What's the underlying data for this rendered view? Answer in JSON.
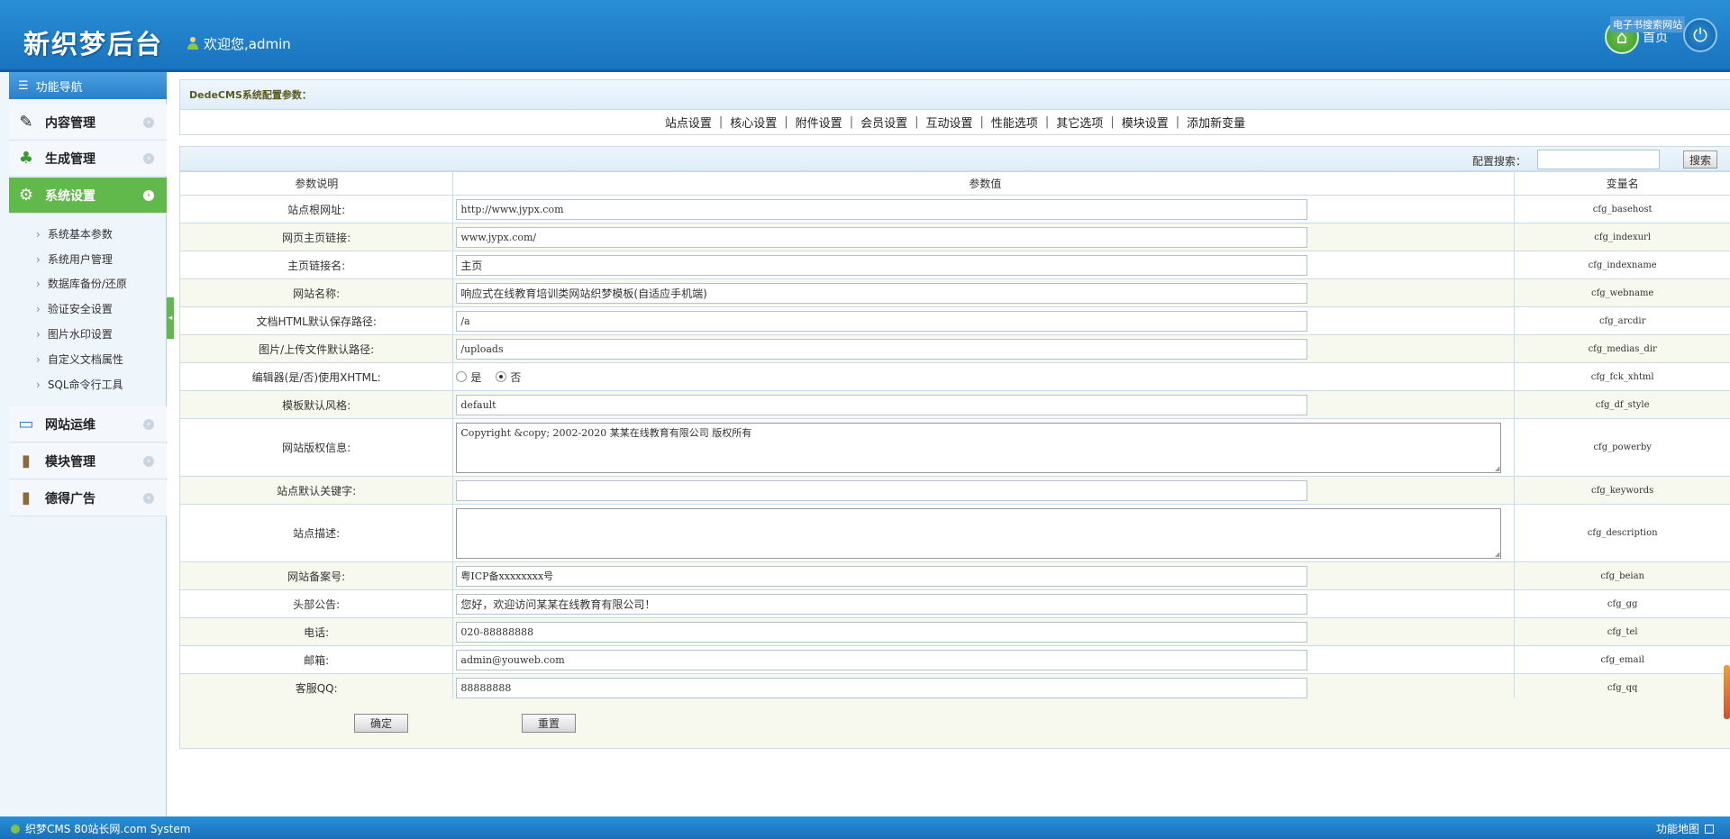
{
  "header": {
    "logo": "新织梦后台",
    "welcome": "欢迎您,admin",
    "home_label": "首页",
    "home_tag": "电子书搜索网站"
  },
  "sidebar": {
    "title": "功能导航",
    "sections": [
      {
        "label": "内容管理",
        "icon": "pencil-icon"
      },
      {
        "label": "生成管理",
        "icon": "tree-icon"
      },
      {
        "label": "系统设置",
        "icon": "gears-icon"
      },
      {
        "label": "网站运维",
        "icon": "monitor-icon"
      },
      {
        "label": "模块管理",
        "icon": "book-icon"
      },
      {
        "label": "德得广告",
        "icon": "book-icon"
      }
    ],
    "sub_items": [
      "系统基本参数",
      "系统用户管理",
      "数据库备份/还原",
      "验证安全设置",
      "图片水印设置",
      "自定义文档属性",
      "SQL命令行工具"
    ]
  },
  "main": {
    "title": "DedeCMS系统配置参数：",
    "tabs": [
      "站点设置",
      "核心设置",
      "附件设置",
      "会员设置",
      "互动设置",
      "性能选项",
      "其它选项",
      "模块设置",
      "添加新变量"
    ],
    "search_label": "配置搜索：",
    "search_button": "搜索",
    "columns": [
      "参数说明",
      "参数值",
      "变量名"
    ],
    "rows": [
      {
        "label": "站点根网址:",
        "value": "http://www.jypx.com",
        "var": "cfg_basehost",
        "type": "input"
      },
      {
        "label": "网页主页链接:",
        "value": "www.jypx.com/",
        "var": "cfg_indexurl",
        "type": "input"
      },
      {
        "label": "主页链接名:",
        "value": "主页",
        "var": "cfg_indexname",
        "type": "input"
      },
      {
        "label": "网站名称:",
        "value": "响应式在线教育培训类网站织梦模板(自适应手机端)",
        "var": "cfg_webname",
        "type": "input"
      },
      {
        "label": "文档HTML默认保存路径:",
        "value": "/a",
        "var": "cfg_arcdir",
        "type": "input"
      },
      {
        "label": "图片/上传文件默认路径:",
        "value": "/uploads",
        "var": "cfg_medias_dir",
        "type": "input"
      },
      {
        "label": "编辑器(是/否)使用XHTML:",
        "value": "",
        "var": "cfg_fck_xhtml",
        "type": "radio",
        "options": [
          "是",
          "否"
        ],
        "selected": "否"
      },
      {
        "label": "模板默认风格:",
        "value": "default",
        "var": "cfg_df_style",
        "type": "input"
      },
      {
        "label": "网站版权信息:",
        "value": "Copyright &copy; 2002-2020 某某在线教育有限公司 版权所有",
        "var": "cfg_powerby",
        "type": "textarea"
      },
      {
        "label": "站点默认关键字:",
        "value": "",
        "var": "cfg_keywords",
        "type": "input"
      },
      {
        "label": "站点描述:",
        "value": "",
        "var": "cfg_description",
        "type": "textarea"
      },
      {
        "label": "网站备案号:",
        "value": "粤ICP备xxxxxxxx号",
        "var": "cfg_beian",
        "type": "input"
      },
      {
        "label": "头部公告:",
        "value": "您好，欢迎访问某某在线教育有限公司！",
        "var": "cfg_gg",
        "type": "input"
      },
      {
        "label": "电话:",
        "value": "020-88888888",
        "var": "cfg_tel",
        "type": "input"
      },
      {
        "label": "邮箱:",
        "value": "admin@youweb.com",
        "var": "cfg_email",
        "type": "input"
      },
      {
        "label": "客服QQ:",
        "value": "88888888",
        "var": "cfg_qq",
        "type": "input"
      }
    ],
    "confirm_button": "确定",
    "reset_button": "重置"
  },
  "footer": {
    "left": "织梦CMS  80站长网.com System",
    "right": "功能地图"
  }
}
